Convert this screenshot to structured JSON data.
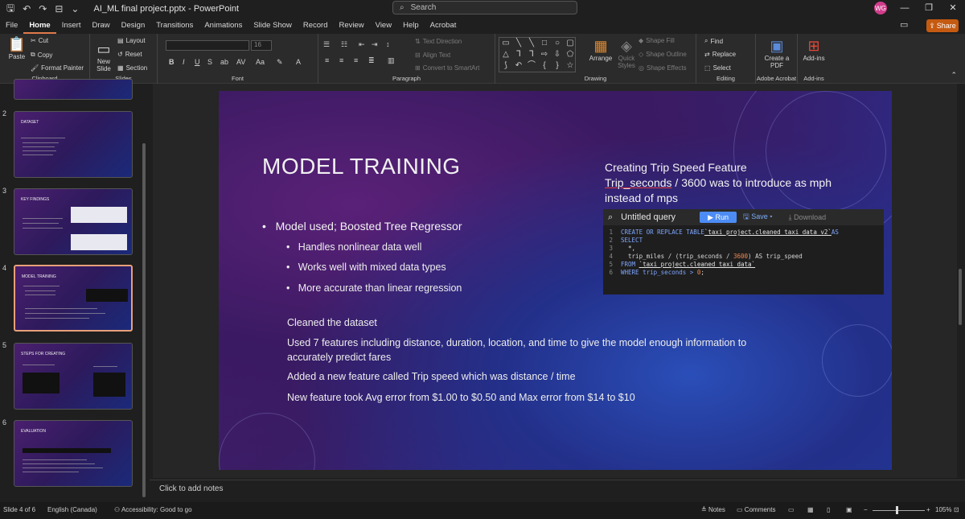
{
  "titlebar": {
    "filename": "AI_ML final project.pptx",
    "separator": "-",
    "app": "PowerPoint",
    "search_placeholder": "Search",
    "avatar_initials": "WG"
  },
  "menu": {
    "tabs": [
      "File",
      "Home",
      "Insert",
      "Draw",
      "Design",
      "Transitions",
      "Animations",
      "Slide Show",
      "Record",
      "Review",
      "View",
      "Help",
      "Acrobat"
    ],
    "share": "Share"
  },
  "ribbon": {
    "clipboard": {
      "paste": "Paste",
      "cut": "Cut",
      "copy": "Copy",
      "format_painter": "Format Painter",
      "label": "Clipboard"
    },
    "slides": {
      "new_slide": "New Slide",
      "layout": "Layout",
      "reset": "Reset",
      "section": "Section",
      "label": "Slides"
    },
    "font": {
      "label": "Font",
      "size": "16"
    },
    "paragraph": {
      "text_direction": "Text Direction",
      "align_text": "Align Text",
      "convert": "Convert to SmartArt",
      "label": "Paragraph"
    },
    "drawing": {
      "arrange": "Arrange",
      "quick_styles": "Quick Styles",
      "shape_fill": "Shape Fill",
      "shape_outline": "Shape Outline",
      "shape_effects": "Shape Effects",
      "label": "Drawing"
    },
    "editing": {
      "find": "Find",
      "replace": "Replace",
      "select": "Select",
      "label": "Editing"
    },
    "acrobat": {
      "create_pdf": "Create a PDF",
      "label": "Adobe Acrobat"
    },
    "addins": {
      "addins": "Add-ins",
      "label": "Add-ins"
    }
  },
  "thumbnails": [
    {
      "num": "2",
      "title": "DATASET"
    },
    {
      "num": "3",
      "title": "KEY FINDINGS"
    },
    {
      "num": "4",
      "title": "MODEL TRAINING"
    },
    {
      "num": "5",
      "title": "STEPS FOR CREATING"
    },
    {
      "num": "6",
      "title": "EVALUATION"
    }
  ],
  "slide": {
    "title": "MODEL TRAINING",
    "bullet_main": "Model used; Boosted Tree Regressor",
    "sub_bullets": [
      "Handles nonlinear data well",
      "Works well with mixed data types",
      "More accurate than linear regression"
    ],
    "cleaned": "Cleaned the dataset",
    "para1": "Used 7 features including distance, duration, location, and time to give the model enough information to accurately predict fares",
    "para2": "Added a new feature called Trip speed which was distance / time",
    "para3": "New feature took Avg error from $1.00 to $0.50 and Max error from $14 to $10",
    "trip_heading": "Creating Trip Speed Feature",
    "trip_line1_a": "Trip_seconds",
    "trip_line1_b": " / 3600 was to introduce as mph",
    "trip_line2": "instead of mps"
  },
  "query": {
    "name": "Untitled query",
    "run": "Run",
    "save": "Save",
    "download": "Download",
    "lines": [
      {
        "n": "1",
        "a": "CREATE OR REPLACE TABLE ",
        "b": "`taxi_project.cleaned_taxi_data_v2`",
        "c": " AS"
      },
      {
        "n": "2",
        "a": "SELECT",
        "b": "",
        "c": ""
      },
      {
        "n": "3",
        "a": "  *,",
        "b": "",
        "c": ""
      },
      {
        "n": "4",
        "a": "  trip_miles / (trip_seconds / ",
        "b": "3600",
        "c": ") AS trip_speed"
      },
      {
        "n": "5",
        "a": "FROM ",
        "b": "`taxi_project.cleaned_taxi_data`",
        "c": ""
      },
      {
        "n": "6",
        "a": "WHERE trip_seconds > ",
        "b": "0",
        "c": ";"
      }
    ]
  },
  "notes": {
    "placeholder": "Click to add notes"
  },
  "status": {
    "slide_of": "Slide 4 of 6",
    "language": "English (Canada)",
    "accessibility": "Accessibility: Good to go",
    "notes": "Notes",
    "comments": "Comments",
    "zoom": "105%"
  }
}
